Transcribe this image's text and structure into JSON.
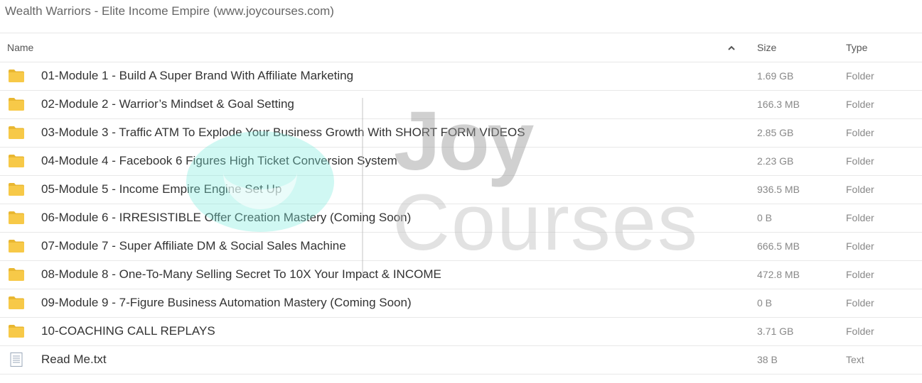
{
  "page": {
    "title": "Wealth Warriors - Elite Income Empire (www.joycourses.com)"
  },
  "table": {
    "columns": {
      "name": "Name",
      "size": "Size",
      "type": "Type"
    },
    "sort_icon": "chevron-up-icon",
    "rows": [
      {
        "name": "01-Module 1 - Build A Super Brand With Affiliate Marketing",
        "size": "1.69 GB",
        "type": "Folder",
        "icon": "folder-icon"
      },
      {
        "name": "02-Module 2 - Warrior’s Mindset & Goal Setting",
        "size": "166.3 MB",
        "type": "Folder",
        "icon": "folder-icon"
      },
      {
        "name": "03-Module 3 - Traffic ATM To Explode Your Business Growth With SHORT FORM VIDEOS",
        "size": "2.85 GB",
        "type": "Folder",
        "icon": "folder-icon"
      },
      {
        "name": "04-Module 4 - Facebook 6 Figures High Ticket Conversion System",
        "size": "2.23 GB",
        "type": "Folder",
        "icon": "folder-icon"
      },
      {
        "name": "05-Module 5 - Income Empire Engine Set Up",
        "size": "936.5 MB",
        "type": "Folder",
        "icon": "folder-icon"
      },
      {
        "name": "06-Module 6 - IRRESISTIBLE Offer Creation Mastery (Coming Soon)",
        "size": "0 B",
        "type": "Folder",
        "icon": "folder-icon"
      },
      {
        "name": "07-Module 7 - Super Affiliate DM & Social Sales Machine",
        "size": "666.5 MB",
        "type": "Folder",
        "icon": "folder-icon"
      },
      {
        "name": "08-Module 8 - One-To-Many Selling Secret To 10X Your Impact & INCOME",
        "size": "472.8 MB",
        "type": "Folder",
        "icon": "folder-icon"
      },
      {
        "name": "09-Module 9 - 7-Figure Business Automation Mastery (Coming Soon)",
        "size": "0 B",
        "type": "Folder",
        "icon": "folder-icon"
      },
      {
        "name": "10-COACHING CALL REPLAYS",
        "size": "3.71 GB",
        "type": "Folder",
        "icon": "folder-icon"
      },
      {
        "name": "Read Me.txt",
        "size": "38 B",
        "type": "Text",
        "icon": "text-file-icon"
      }
    ]
  },
  "watermark": {
    "line1": "Joy",
    "line2": "Courses"
  },
  "colors": {
    "folder": "#f7c948",
    "folder_tab": "#e9b731",
    "border": "#e8e8e8",
    "watermark_circle": "#78ecde"
  }
}
